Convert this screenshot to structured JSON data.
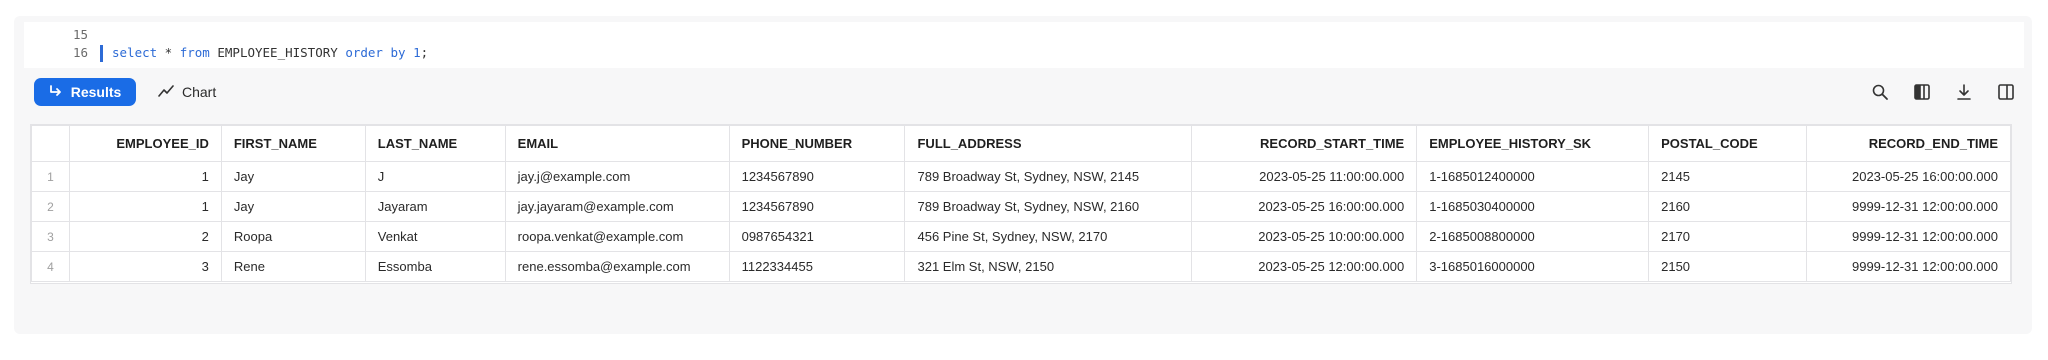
{
  "editor": {
    "lines": [
      {
        "num": "15",
        "tokens": []
      },
      {
        "num": "16",
        "tokens": [
          {
            "t": "select",
            "k": "kw"
          },
          {
            "t": " * ",
            "k": "plain"
          },
          {
            "t": "from",
            "k": "kw"
          },
          {
            "t": " EMPLOYEE_HISTORY ",
            "k": "plain"
          },
          {
            "t": "order by",
            "k": "kw"
          },
          {
            "t": " ",
            "k": "plain"
          },
          {
            "t": "1",
            "k": "num"
          },
          {
            "t": ";",
            "k": "plain"
          }
        ]
      }
    ]
  },
  "toolbar": {
    "results_label": "Results",
    "chart_label": "Chart",
    "icons": [
      "search-icon",
      "columns-icon",
      "download-icon",
      "split-panel-icon"
    ]
  },
  "colors": {
    "accent": "#1a6ce6",
    "keyword": "#2d6bd6"
  },
  "table": {
    "columns": [
      {
        "label": "EMPLOYEE_ID",
        "align": "r"
      },
      {
        "label": "FIRST_NAME",
        "align": "l"
      },
      {
        "label": "LAST_NAME",
        "align": "l"
      },
      {
        "label": "EMAIL",
        "align": "l"
      },
      {
        "label": "PHONE_NUMBER",
        "align": "l"
      },
      {
        "label": "FULL_ADDRESS",
        "align": "l"
      },
      {
        "label": "RECORD_START_TIME",
        "align": "r"
      },
      {
        "label": "EMPLOYEE_HISTORY_SK",
        "align": "l"
      },
      {
        "label": "POSTAL_CODE",
        "align": "l"
      },
      {
        "label": "RECORD_END_TIME",
        "align": "r"
      }
    ],
    "rows": [
      {
        "n": "1",
        "cells": [
          "1",
          "Jay",
          "J",
          "jay.j@example.com",
          "1234567890",
          "789 Broadway St, Sydney, NSW, 2145",
          "2023-05-25 11:00:00.000",
          "1-1685012400000",
          "2145",
          "2023-05-25 16:00:00.000"
        ]
      },
      {
        "n": "2",
        "cells": [
          "1",
          "Jay",
          "Jayaram",
          "jay.jayaram@example.com",
          "1234567890",
          "789 Broadway St, Sydney, NSW, 2160",
          "2023-05-25 16:00:00.000",
          "1-1685030400000",
          "2160",
          "9999-12-31 12:00:00.000"
        ]
      },
      {
        "n": "3",
        "cells": [
          "2",
          "Roopa",
          "Venkat",
          "roopa.venkat@example.com",
          "0987654321",
          "456 Pine St, Sydney, NSW, 2170",
          "2023-05-25 10:00:00.000",
          "2-1685008800000",
          "2170",
          "9999-12-31 12:00:00.000"
        ]
      },
      {
        "n": "4",
        "cells": [
          "3",
          "Rene",
          "Essomba",
          "rene.essomba@example.com",
          "1122334455",
          "321 Elm St, NSW, 2150",
          "2023-05-25 12:00:00.000",
          "3-1685016000000",
          "2150",
          "9999-12-31 12:00:00.000"
        ]
      }
    ]
  }
}
